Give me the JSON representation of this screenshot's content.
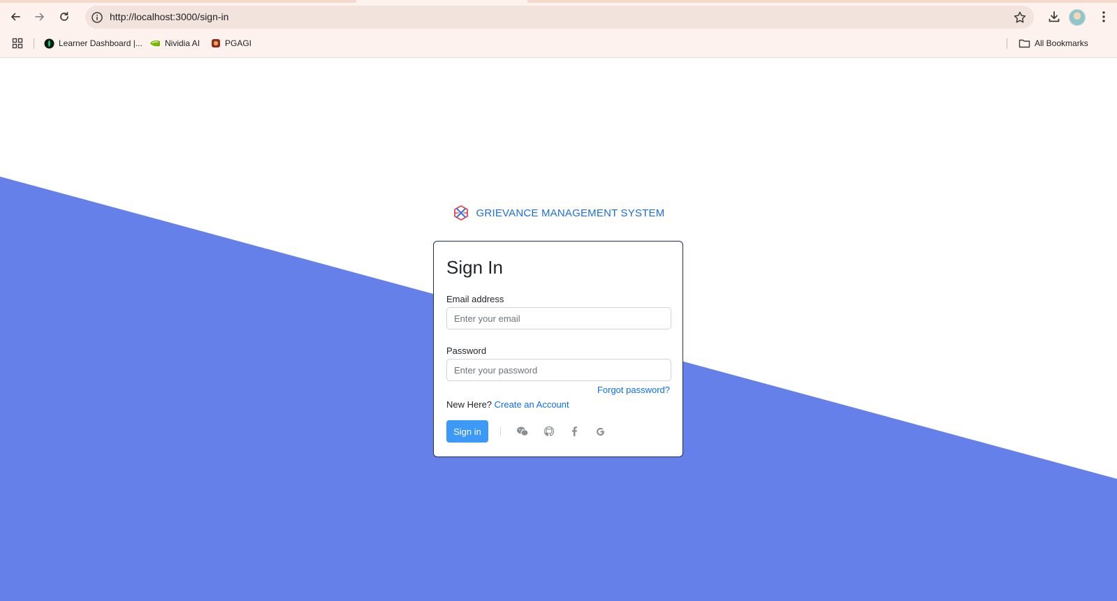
{
  "browser": {
    "url": "http://localhost:3000/sign-in",
    "bookmarks": [
      {
        "label": "Learner Dashboard |...",
        "icon": "leaf-icon"
      },
      {
        "label": "Nividia AI",
        "icon": "nvidia-icon"
      },
      {
        "label": "PGAGI",
        "icon": "pgagi-icon"
      }
    ],
    "all_bookmarks_label": "All Bookmarks"
  },
  "brand": {
    "name": "GRIEVANCE MANAGEMENT SYSTEM",
    "color": "#1e6fd9"
  },
  "signin": {
    "title": "Sign In",
    "email_label": "Email address",
    "email_placeholder": "Enter your email",
    "password_label": "Password",
    "password_placeholder": "Enter your password",
    "forgot_label": "Forgot password?",
    "new_here_text": "New Here?",
    "create_account_label": "Create an Account",
    "submit_label": "Sign in",
    "social_icons": [
      "wechat-icon",
      "github-icon",
      "facebook-icon",
      "google-icon"
    ]
  },
  "colors": {
    "background_accent": "#6680ea",
    "button_primary": "#3c99f7",
    "link": "#0d6efd"
  }
}
